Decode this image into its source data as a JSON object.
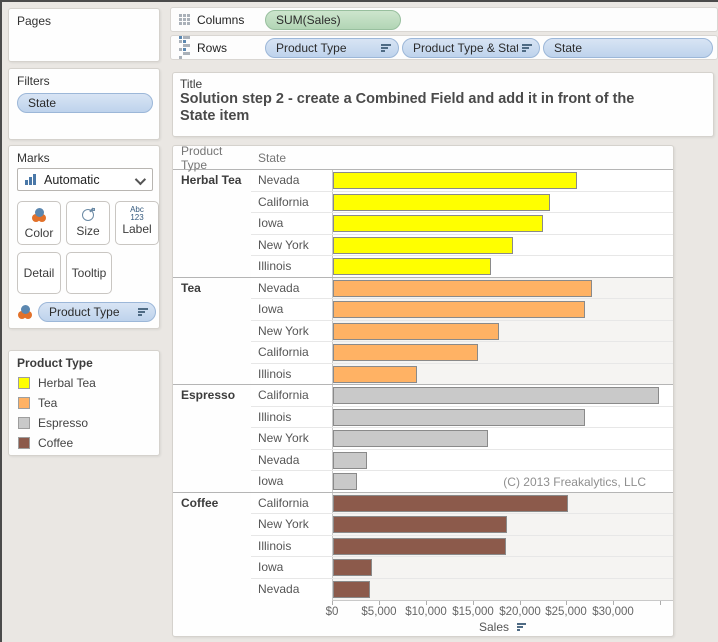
{
  "shelves": {
    "columns": {
      "label": "Columns",
      "pills": [
        {
          "text": "SUM(Sales)",
          "kind": "measure",
          "sort": false
        }
      ]
    },
    "rows": {
      "label": "Rows",
      "pills": [
        {
          "text": "Product Type",
          "kind": "dimension",
          "sort": true
        },
        {
          "text": "Product Type & State ..",
          "kind": "dimension",
          "sort": true
        },
        {
          "text": "State",
          "kind": "dimension",
          "sort": false
        }
      ]
    }
  },
  "left_panel": {
    "pages": {
      "title": "Pages"
    },
    "filters": {
      "title": "Filters",
      "pills": [
        {
          "text": "State",
          "kind": "dimension",
          "sort": false
        }
      ]
    },
    "marks": {
      "title": "Marks",
      "mark_type": "Automatic",
      "buttons": {
        "color": "Color",
        "size": "Size",
        "label_btn": "Label",
        "detail": "Detail",
        "tooltip": "Tooltip"
      },
      "label_icon_line1": "Abc",
      "label_icon_line2": "123",
      "pill": {
        "text": "Product Type",
        "kind": "dimension",
        "sort": true
      }
    },
    "legend": {
      "title": "Product Type",
      "items": [
        {
          "label": "Herbal Tea",
          "color": "#ffff00"
        },
        {
          "label": "Tea",
          "color": "#ffb264"
        },
        {
          "label": "Espresso",
          "color": "#c9c9c9"
        },
        {
          "label": "Coffee",
          "color": "#8c5a4b"
        }
      ]
    }
  },
  "title_card": {
    "label": "Title",
    "text": "Solution step 2 - create a Combined Field and add it in front of the State item",
    "lines": [
      "Solution step 2 - create a Combined Field and add it in front of the",
      "State item"
    ]
  },
  "colors": {
    "dimension_pill": "#bed3ec",
    "measure_pill": "#b2d5b5",
    "band_row": "#f5f4f2"
  },
  "chart_data": {
    "type": "bar",
    "orientation": "horizontal",
    "col_headers": {
      "product": "Product Type",
      "state": "State"
    },
    "xlabel": "Sales",
    "annotation": "(C) 2013 Freakalytics, LLC",
    "xlim": [
      0,
      36250
    ],
    "x_ticks": [
      {
        "value": 0,
        "label": "$0"
      },
      {
        "value": 5000,
        "label": "$5,000"
      },
      {
        "value": 10000,
        "label": "$10,000"
      },
      {
        "value": 15000,
        "label": "$15,000"
      },
      {
        "value": 20000,
        "label": "$20,000"
      },
      {
        "value": 25000,
        "label": "$25,000"
      },
      {
        "value": 30000,
        "label": "$30,000"
      },
      {
        "value": 35000,
        "label": ""
      }
    ],
    "groups": [
      {
        "product_type": "Herbal Tea",
        "color": "#ffff00",
        "rows": [
          {
            "state": "Nevada",
            "sales": 25800
          },
          {
            "state": "California",
            "sales": 22900
          },
          {
            "state": "Iowa",
            "sales": 22200
          },
          {
            "state": "New York",
            "sales": 19000
          },
          {
            "state": "Illinois",
            "sales": 16600
          }
        ]
      },
      {
        "product_type": "Tea",
        "color": "#ffb264",
        "rows": [
          {
            "state": "Nevada",
            "sales": 27400
          },
          {
            "state": "Iowa",
            "sales": 26700
          },
          {
            "state": "New York",
            "sales": 17500
          },
          {
            "state": "California",
            "sales": 15200
          },
          {
            "state": "Illinois",
            "sales": 8700
          }
        ]
      },
      {
        "product_type": "Espresso",
        "color": "#c9c9c9",
        "rows": [
          {
            "state": "California",
            "sales": 34500
          },
          {
            "state": "Illinois",
            "sales": 26700
          },
          {
            "state": "New York",
            "sales": 16300
          },
          {
            "state": "Nevada",
            "sales": 3400
          },
          {
            "state": "Iowa",
            "sales": 2300
          }
        ]
      },
      {
        "product_type": "Coffee",
        "color": "#8c5a4b",
        "rows": [
          {
            "state": "California",
            "sales": 24800
          },
          {
            "state": "New York",
            "sales": 18300
          },
          {
            "state": "Illinois",
            "sales": 18200
          },
          {
            "state": "Iowa",
            "sales": 3900
          },
          {
            "state": "Nevada",
            "sales": 3700
          }
        ]
      }
    ]
  }
}
